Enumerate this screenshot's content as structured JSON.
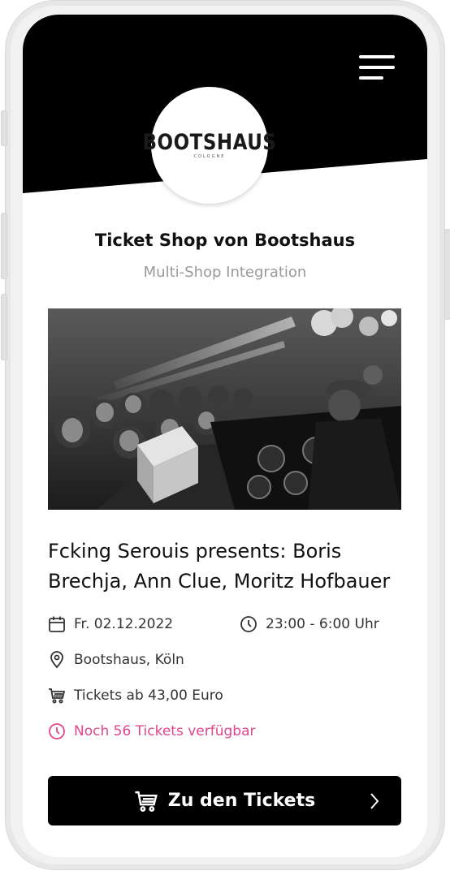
{
  "header": {
    "logo_text": "BOOTSHAUS",
    "logo_subtext": "COLOGNE"
  },
  "shop": {
    "title": "Ticket Shop von Bootshaus",
    "subtitle": "Multi-Shop Integration"
  },
  "event": {
    "title": "Fcking Serouis presents: Boris Brechja, Ann Clue, Moritz Hofbauer",
    "date": "Fr. 02.12.2022",
    "time": "23:00 - 6:00 Uhr",
    "location": "Bootshaus, Köln",
    "price": "Tickets ab 43,00 Euro",
    "availability": "Noch 56 Tickets verfügbar"
  },
  "cta": {
    "label": "Zu den Tickets"
  },
  "icons": {
    "menu": "hamburger-menu-icon",
    "date": "calendar-icon",
    "time": "clock-icon",
    "location": "map-pin-icon",
    "price": "shopping-cart-icon",
    "availability": "clock-icon",
    "cta": "shopping-cart-icon",
    "cta_arrow": "chevron-right-icon"
  },
  "colors": {
    "header": "#000000",
    "accent_pink": "#e0478b",
    "subtitle_gray": "#9a9a9a",
    "button": "#000000"
  }
}
